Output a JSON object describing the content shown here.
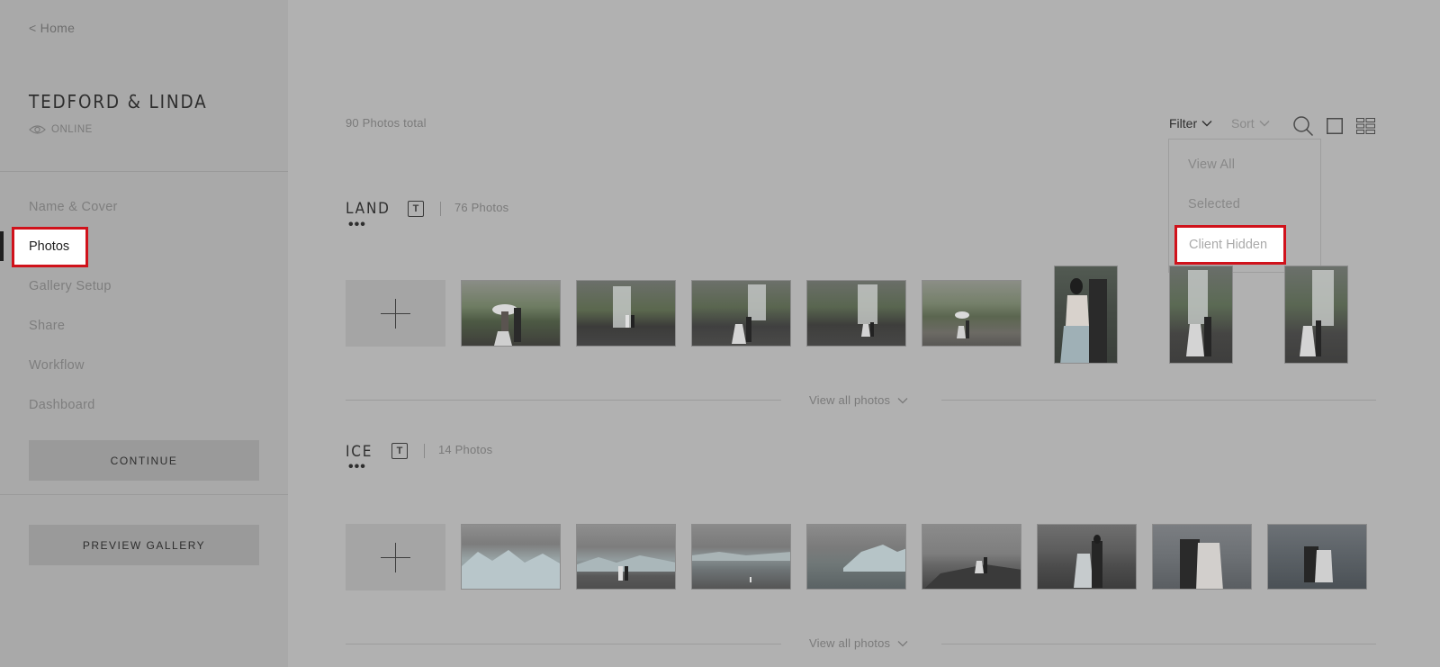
{
  "sidebar": {
    "home_link": "< Home",
    "gallery_title": "TEDFORD & LINDA",
    "status": "ONLINE",
    "nav": [
      "Name & Cover",
      "Photos",
      "Gallery Setup",
      "Share",
      "Workflow",
      "Dashboard"
    ],
    "active_nav": "Photos",
    "continue_label": "CONTINUE",
    "preview_label": "PREVIEW GALLERY"
  },
  "main": {
    "total": "90 Photos total",
    "toolbar": {
      "filter_label": "Filter",
      "sort_label": "Sort"
    },
    "filter_menu": [
      "View All",
      "Selected",
      "Client Hidden"
    ],
    "highlighted_filter": "Client Hidden",
    "view_all_label": "View all photos",
    "sets": [
      {
        "title": "LAND",
        "t_icon": "T",
        "count": "76 Photos"
      },
      {
        "title": "ICE",
        "t_icon": "T",
        "count": "14 Photos"
      }
    ]
  },
  "colors": {
    "highlight_border": "#d0121b",
    "overlay_bg": "#b1b1b1",
    "sidebar_bg": "#a9a9a9"
  }
}
